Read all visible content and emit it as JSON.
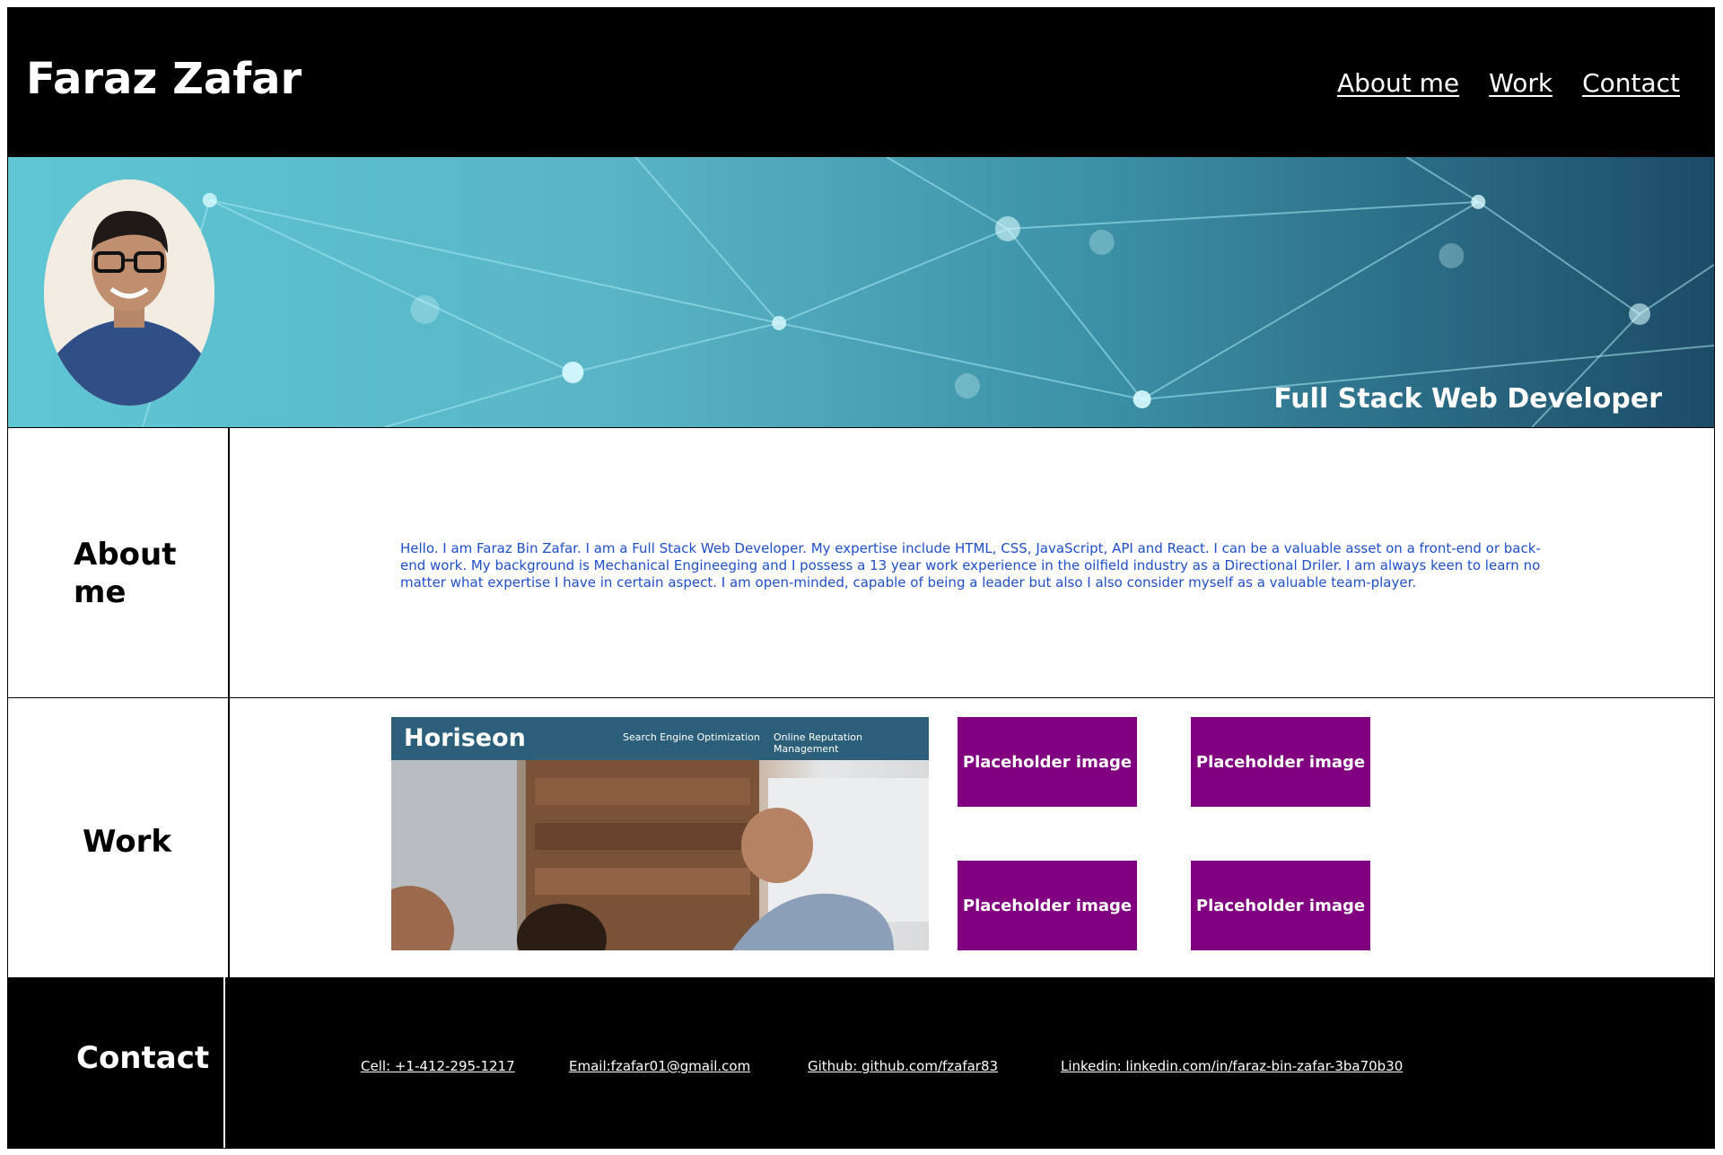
{
  "header": {
    "title": "Faraz Zafar",
    "nav": [
      "About me",
      "Work",
      "Contact"
    ]
  },
  "hero": {
    "tagline": "Full Stack Web Developer"
  },
  "about": {
    "heading": "About me",
    "text": "Hello. I am Faraz Bin Zafar. I am a Full Stack Web Developer. My expertise include HTML, CSS, JavaScript, API and React. I can be a valuable asset on a front-end or back-end work. My background is Mechanical Engineeging and I possess a 13 year work experience in the oilfield industry as a Directional Driler. I am always keen to learn no matter what expertise I have in certain aspect. I am open-minded, capable of being a leader but also I also consider myself as a valuable team-player."
  },
  "work": {
    "heading": "Work",
    "featured": {
      "brand": "Horiseon",
      "links": [
        "Search Engine Optimization",
        "Online Reputation Management"
      ]
    },
    "placeholders": [
      "Placeholder image",
      "Placeholder image",
      "Placeholder image",
      "Placeholder image"
    ]
  },
  "contact": {
    "heading": "Contact",
    "links": [
      "Cell: +1-412-295-1217",
      "Email:fzafar01@gmail.com",
      "Github: github.com/fzafar83",
      "Linkedin: linkedin.com/in/faraz-bin-zafar-3ba70b30"
    ]
  },
  "colors": {
    "header_bg": "#000000",
    "about_text": "#1f4fc9",
    "placeholder_bg": "#800080"
  }
}
